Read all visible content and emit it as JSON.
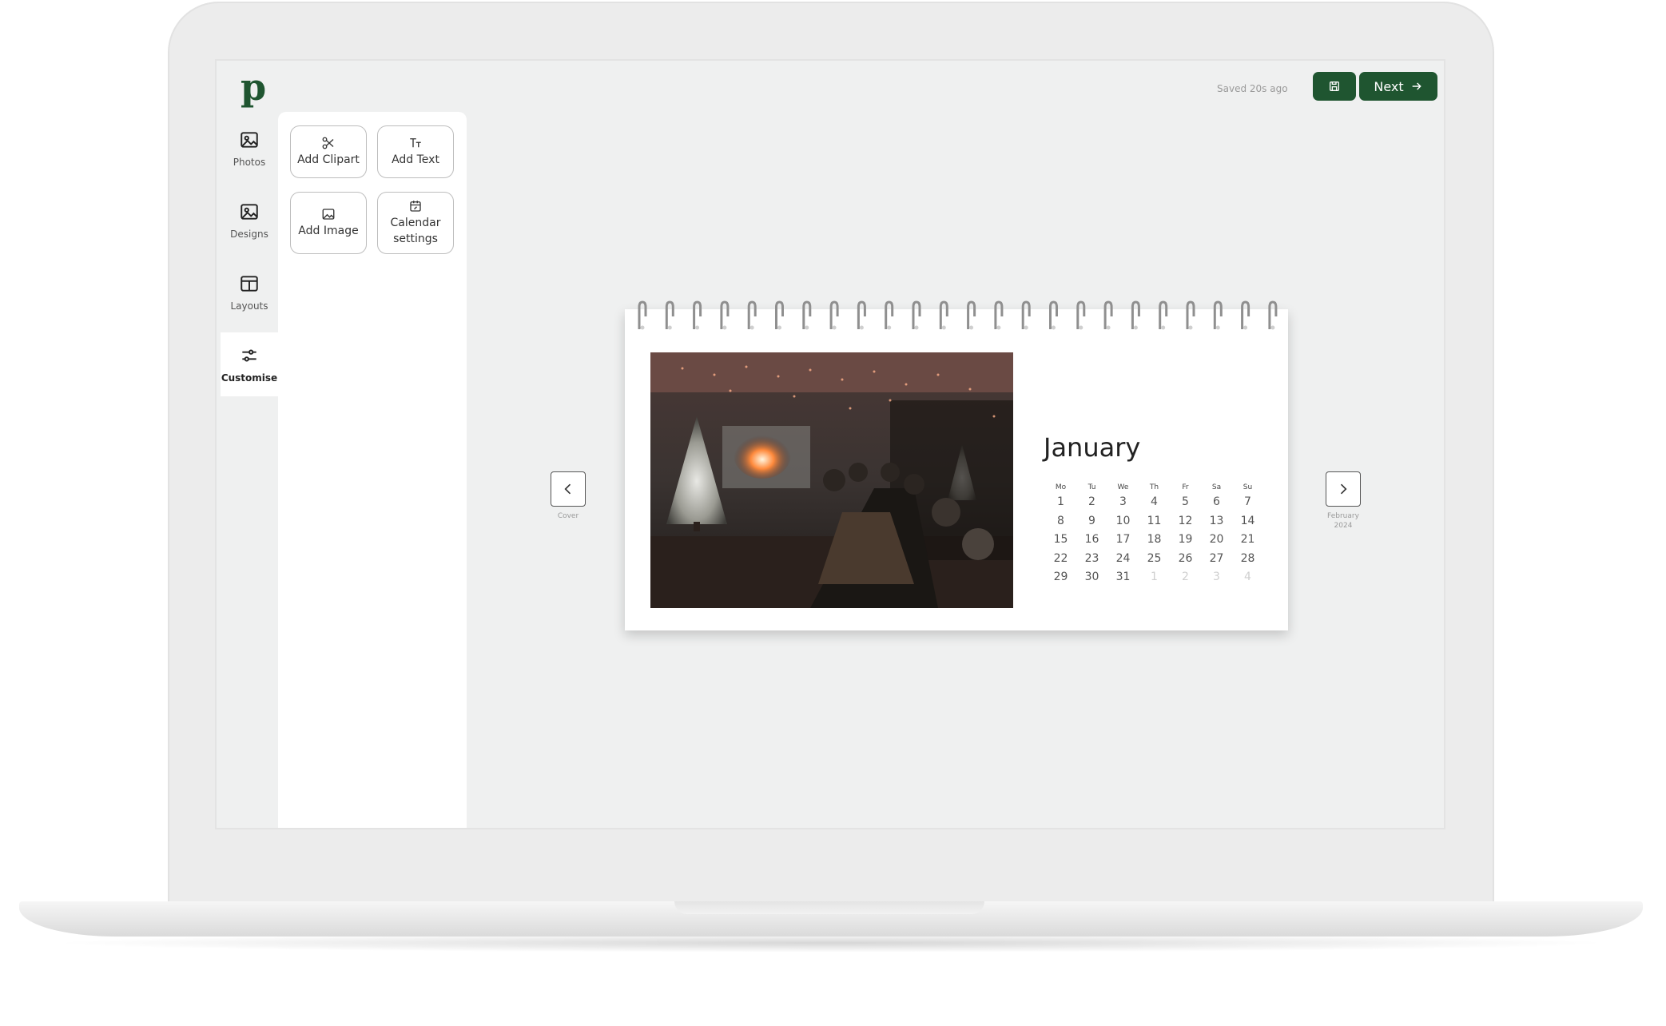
{
  "app": {
    "logo": "p",
    "saved_status": "Saved 20s ago",
    "next_label": "Next",
    "accent_color": "#1f5530"
  },
  "sidebar": {
    "items": [
      {
        "label": "Photos",
        "icon": "image-icon"
      },
      {
        "label": "Designs",
        "icon": "image-icon"
      },
      {
        "label": "Layouts",
        "icon": "layout-icon"
      },
      {
        "label": "Customise",
        "icon": "sliders-icon",
        "active": true
      }
    ]
  },
  "tools": {
    "add_clipart": "Add Clipart",
    "add_text": "Add Text",
    "add_image": "Add Image",
    "calendar_settings_line1": "Calendar",
    "calendar_settings_line2": "settings"
  },
  "navigation": {
    "prev_label": "Cover",
    "next_label_line1": "February",
    "next_label_line2": "2024"
  },
  "calendar": {
    "month": "January",
    "weekdays": [
      "Mo",
      "Tu",
      "We",
      "Th",
      "Fr",
      "Sa",
      "Su"
    ],
    "days": [
      "1",
      "2",
      "3",
      "4",
      "5",
      "6",
      "7",
      "8",
      "9",
      "10",
      "11",
      "12",
      "13",
      "14",
      "15",
      "16",
      "17",
      "18",
      "19",
      "20",
      "21",
      "22",
      "23",
      "24",
      "25",
      "26",
      "27",
      "28",
      "29",
      "30",
      "31",
      "1",
      "2",
      "3",
      "4"
    ],
    "dim_from_index": 31
  }
}
